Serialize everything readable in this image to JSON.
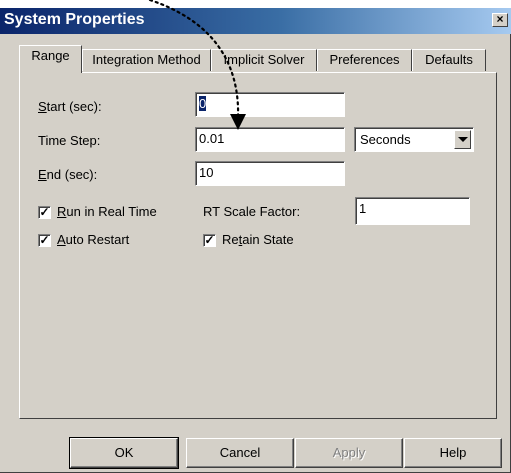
{
  "window": {
    "title": "System Properties",
    "close_glyph": "×"
  },
  "tabs": [
    {
      "label": "Range",
      "active": true
    },
    {
      "label": "Integration Method",
      "active": false
    },
    {
      "label": "Implicit Solver",
      "active": false
    },
    {
      "label": "Preferences",
      "active": false
    },
    {
      "label": "Defaults",
      "active": false
    }
  ],
  "range": {
    "start": {
      "label_mnemonic": "S",
      "label_rest": "tart (sec):",
      "value": "0"
    },
    "time_step": {
      "label": "Time Step:",
      "value": "0.01",
      "unit": "Seconds"
    },
    "end": {
      "label_mnemonic": "E",
      "label_rest": "nd (sec):",
      "value": "10"
    },
    "run_realtime": {
      "label_mnemonic": "R",
      "label_rest": "un in Real Time",
      "checked": true
    },
    "rt_scale": {
      "label": "RT Scale Factor:",
      "value": "1"
    },
    "auto_restart": {
      "label_mnemonic": "A",
      "label_rest": "uto Restart",
      "checked": true
    },
    "retain_state": {
      "label_pre": "Re",
      "label_mnemonic": "t",
      "label_rest": "ain State",
      "checked": true
    }
  },
  "buttons": {
    "ok": "OK",
    "cancel": "Cancel",
    "apply": "Apply",
    "help": "Help"
  },
  "icons": {
    "check_glyph": "✓",
    "close": "close-icon",
    "dropdown": "chevron-down-icon"
  },
  "colors": {
    "title_start": "#0a246a",
    "title_end": "#a6caf0",
    "face": "#d4d0c8",
    "selection": "#0a246a"
  }
}
